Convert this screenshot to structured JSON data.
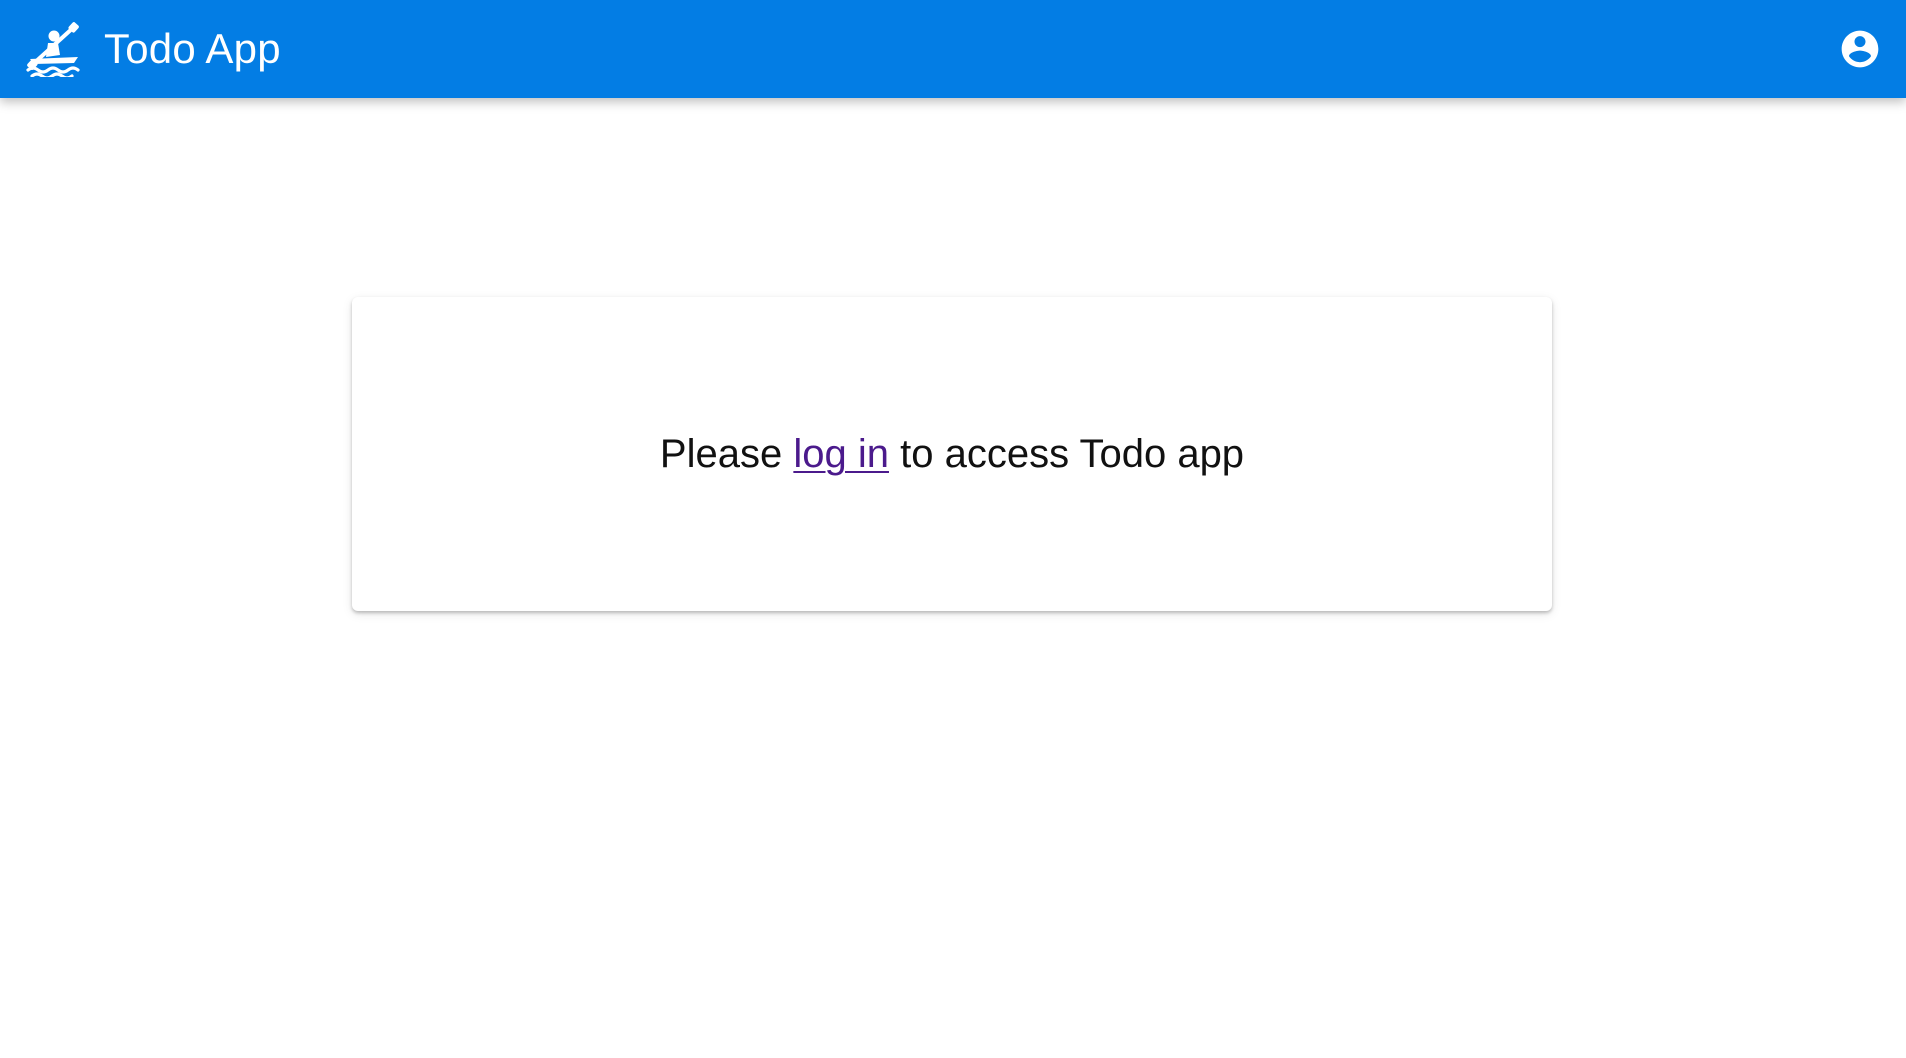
{
  "header": {
    "logo_icon": "kayaking-icon",
    "title": "Todo App",
    "account_icon": "account-circle-icon",
    "background_color": "#037DE4",
    "text_color": "#FFFFFF"
  },
  "main": {
    "message_prefix": "Please",
    "login_link_label": "log in",
    "message_suffix": "to access Todo app",
    "link_color": "#4B1A8C"
  }
}
